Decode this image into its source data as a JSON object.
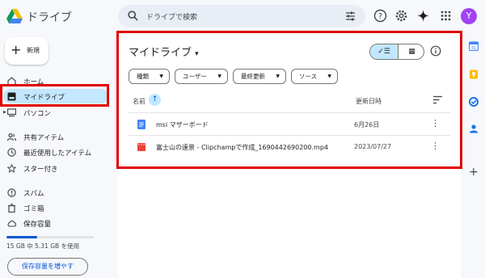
{
  "header": {
    "app_title": "ドライブ",
    "search_placeholder": "ドライブで検索",
    "avatar_letter": "Y",
    "icons": [
      "drive-logo",
      "search-icon",
      "tune-icon",
      "help-icon",
      "settings-icon",
      "gemini-icon",
      "apps-icon"
    ]
  },
  "sidebar": {
    "new_label": "新規",
    "items": [
      {
        "label": "ホーム",
        "icon": "home-icon"
      },
      {
        "label": "マイドライブ",
        "icon": "drive-icon",
        "active": true
      },
      {
        "label": "パソコン",
        "icon": "computer-icon"
      },
      {
        "label": "共有アイテム",
        "icon": "people-icon"
      },
      {
        "label": "最近使用したアイテム",
        "icon": "clock-icon"
      },
      {
        "label": "スター付き",
        "icon": "star-icon"
      },
      {
        "label": "スパム",
        "icon": "spam-icon"
      },
      {
        "label": "ゴミ箱",
        "icon": "trash-icon"
      },
      {
        "label": "保存容量",
        "icon": "cloud-icon"
      }
    ],
    "storage_text": "15 GB 中 5.31 GB を使用",
    "storage_fraction": 0.354,
    "get_storage_label": "保存容量を増やす"
  },
  "main": {
    "title": "マイドライブ",
    "title_caret": "▾",
    "filters": [
      "種類",
      "ユーザー",
      "最終更新",
      "ソース"
    ],
    "columns": {
      "name": "名前",
      "modified": "更新日時"
    },
    "files": [
      {
        "name": "msi マザーボード",
        "date": "6月26日",
        "icon": "docs-icon"
      },
      {
        "name": "富士山の遠景 - Clipchampで作成_1690442690200.mp4",
        "date": "2023/07/27",
        "icon": "video-icon"
      }
    ],
    "more_glyph": "⋮",
    "view_list_glyph": "✓☰",
    "view_grid_glyph": "▦"
  },
  "right_rail": {
    "icons": [
      "calendar-icon",
      "keep-icon",
      "tasks-icon",
      "contacts-icon"
    ],
    "add_glyph": "+"
  },
  "colors": {
    "highlight": "#e00000",
    "accent": "#0b57d0",
    "selected_bg": "#c2e7ff",
    "page_bg": "#f6f8fc"
  }
}
